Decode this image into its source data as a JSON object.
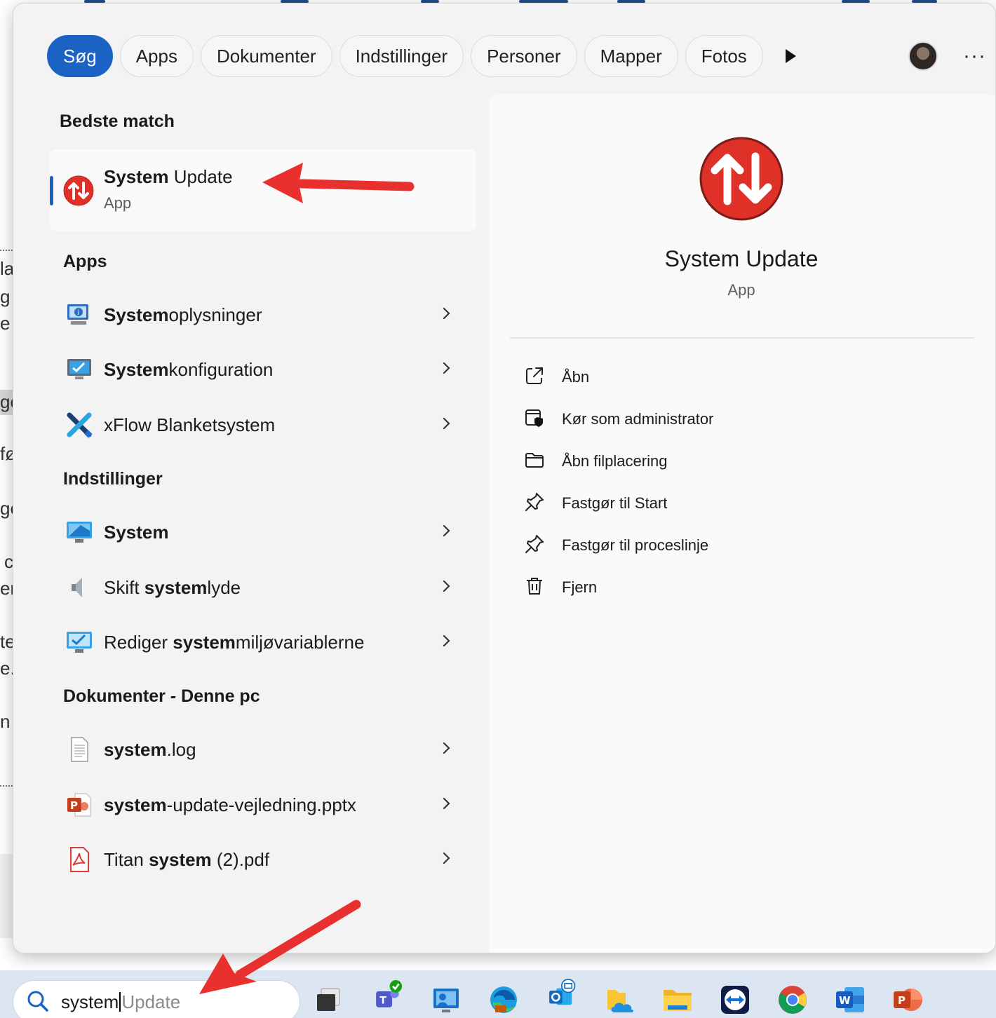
{
  "background_doc": {
    "fragments": [
      "la",
      "g",
      "e",
      "ge",
      "fø",
      "ge",
      "c",
      "er",
      "te",
      "e.",
      "n"
    ]
  },
  "filters": {
    "chips": [
      "Søg",
      "Apps",
      "Dokumenter",
      "Indstillinger",
      "Personer",
      "Mapper",
      "Fotos"
    ],
    "active_index": 0,
    "more_label": "···"
  },
  "best_match": {
    "heading": "Bedste match",
    "title_bold": "System",
    "title_rest": " Update",
    "subtitle": "App"
  },
  "apps": {
    "heading": "Apps",
    "items": [
      {
        "bold": "System",
        "rest": "oplysninger",
        "icon": "system-information-icon"
      },
      {
        "bold": "System",
        "rest": "konfiguration",
        "icon": "system-configuration-icon"
      },
      {
        "pre": "xFlow Blanketsystem",
        "icon": "xflow-icon"
      }
    ]
  },
  "settings": {
    "heading": "Indstillinger",
    "items": [
      {
        "bold": "System",
        "icon": "monitor-icon"
      },
      {
        "pre": "Skift ",
        "bold": "system",
        "rest": "lyde",
        "icon": "speaker-icon"
      },
      {
        "pre": "Rediger ",
        "bold": "system",
        "rest": "miljøvariablerne",
        "icon": "monitor-check-icon"
      }
    ]
  },
  "documents": {
    "heading": "Dokumenter - Denne pc",
    "items": [
      {
        "bold": "system",
        "rest": ".log",
        "icon": "text-file-icon"
      },
      {
        "bold": "system",
        "rest": "-update-vejledning.pptx",
        "icon": "powerpoint-file-icon"
      },
      {
        "pre": "Titan ",
        "bold": "system",
        "rest": " (2).pdf",
        "icon": "pdf-file-icon"
      }
    ]
  },
  "details": {
    "title": "System Update",
    "subtitle": "App",
    "actions": [
      {
        "label": "Åbn",
        "icon": "open-external-icon"
      },
      {
        "label": "Kør som administrator",
        "icon": "shield-admin-icon"
      },
      {
        "label": "Åbn filplacering",
        "icon": "folder-icon"
      },
      {
        "label": "Fastgør til Start",
        "icon": "pin-icon"
      },
      {
        "label": "Fastgør til proceslinje",
        "icon": "pin-icon"
      },
      {
        "label": "Fjern",
        "icon": "trash-icon"
      }
    ]
  },
  "taskbar": {
    "search_typed": "system",
    "search_hint": "Update",
    "apps": [
      "task-view",
      "teams",
      "remote-desktop",
      "edge",
      "outlook",
      "onedrive-folder",
      "file-explorer",
      "teamviewer",
      "chrome",
      "word",
      "powerpoint"
    ]
  },
  "colors": {
    "accent": "#1a63c4",
    "annotation_red": "#e8312f",
    "system_update_red": "#e03128"
  }
}
